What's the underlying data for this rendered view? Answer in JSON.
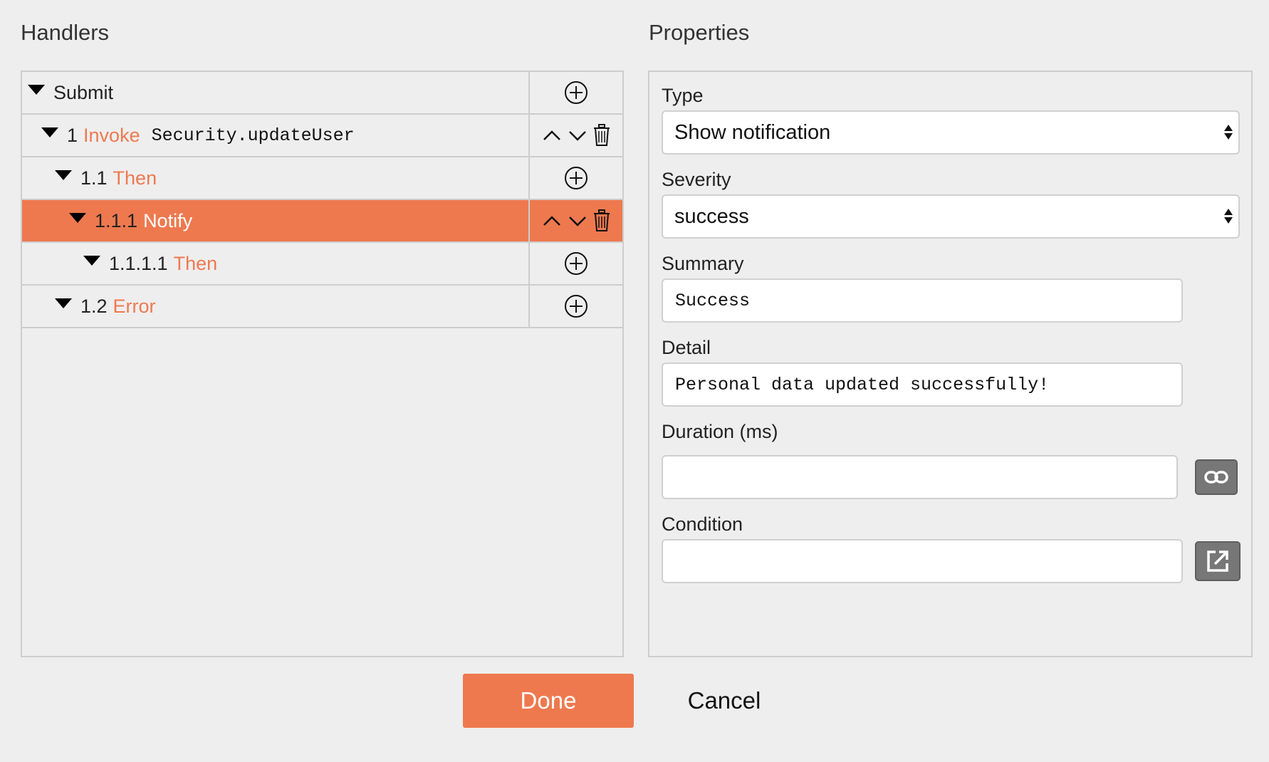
{
  "handlers": {
    "title": "Handlers",
    "rows": [
      {
        "num": "",
        "keyword": "",
        "label": "Submit",
        "arg": "",
        "actions": "add",
        "indent": 0
      },
      {
        "num": "1",
        "keyword": "Invoke",
        "label": "",
        "arg": "Security.updateUser",
        "actions": "move-delete",
        "indent": 1
      },
      {
        "num": "1.1",
        "keyword": "Then",
        "label": "",
        "arg": "",
        "actions": "add",
        "indent": 2
      },
      {
        "num": "1.1.1",
        "keyword": "Notify",
        "label": "",
        "arg": "",
        "actions": "move-delete",
        "indent": 3,
        "selected": true
      },
      {
        "num": "1.1.1.1",
        "keyword": "Then",
        "label": "",
        "arg": "",
        "actions": "add",
        "indent": 4
      },
      {
        "num": "1.2",
        "keyword": "Error",
        "label": "",
        "arg": "",
        "actions": "add",
        "indent": 2
      }
    ]
  },
  "properties": {
    "title": "Properties",
    "type": {
      "label": "Type",
      "value": "Show notification"
    },
    "severity": {
      "label": "Severity",
      "value": "success"
    },
    "summary": {
      "label": "Summary",
      "value": "Success"
    },
    "detail": {
      "label": "Detail",
      "value": "Personal data updated successfully!"
    },
    "duration": {
      "label": "Duration (ms)",
      "value": ""
    },
    "condition": {
      "label": "Condition",
      "value": ""
    }
  },
  "footer": {
    "done_label": "Done",
    "cancel_label": "Cancel"
  },
  "colors": {
    "accent": "#ee794f",
    "background": "#eeeeee",
    "border": "#cdcdcd",
    "side_button": "#777777"
  },
  "icons": {
    "add": "plus-circle-icon",
    "up": "chevron-up-icon",
    "down": "chevron-down-icon",
    "delete": "trash-icon",
    "link": "link-icon",
    "open": "external-link-icon"
  }
}
